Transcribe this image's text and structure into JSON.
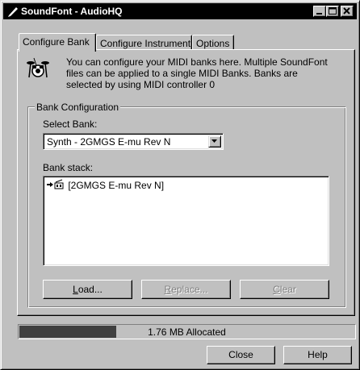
{
  "window": {
    "title": "SoundFont - AudioHQ"
  },
  "tabs": [
    {
      "label": "Configure Bank",
      "active": true
    },
    {
      "label": "Configure Instrument",
      "active": false
    },
    {
      "label": "Options",
      "active": false
    }
  ],
  "info": {
    "line1": "You can configure your MIDI banks here. Multiple SoundFont",
    "line2": "files can be applied to a single MIDI Banks. Banks are",
    "line3": "selected by using MIDI controller 0"
  },
  "bank_config": {
    "group_label": "Bank Configuration",
    "select_bank_label": "Select Bank:",
    "selected_bank": "Synth - 2GMGS E-mu  Rev N",
    "bank_stack_label": "Bank stack:",
    "stack_items": [
      "[2GMGS E-mu  Rev N]"
    ]
  },
  "buttons": {
    "load": {
      "label": "Load...",
      "enabled": true
    },
    "replace": {
      "label": "Replace...",
      "enabled": false
    },
    "clear": {
      "label": "Clear",
      "enabled": false
    },
    "close": "Close",
    "help": "Help"
  },
  "memory": {
    "text": "1.76 MB Allocated",
    "fill_fraction": 0.29
  },
  "icons": [
    "pen-icon",
    "minimize-icon",
    "maximize-icon",
    "close-icon",
    "drum-kit-icon",
    "dropdown-arrow-icon",
    "arrow-instrument-icon"
  ]
}
